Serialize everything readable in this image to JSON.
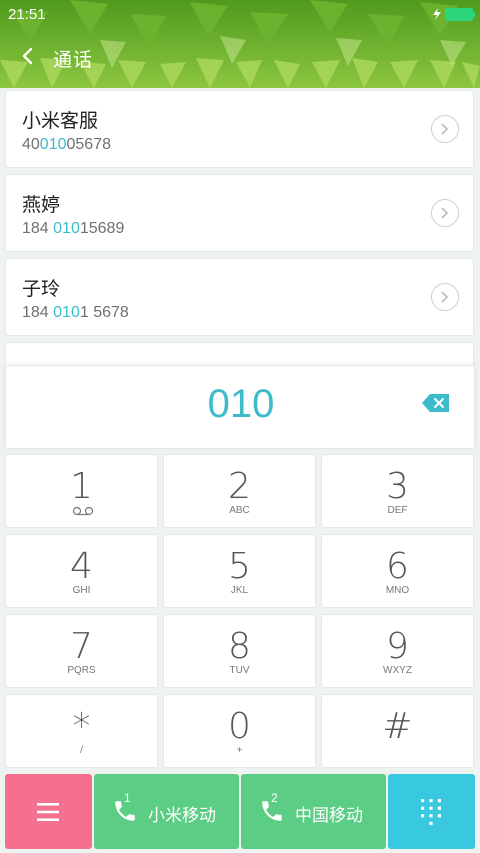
{
  "status_bar": {
    "time": "21:51"
  },
  "header": {
    "title": "通话"
  },
  "contacts": [
    {
      "name": "小米客服",
      "number_parts": [
        "40",
        "010",
        "05678"
      ]
    },
    {
      "name": "燕婷",
      "number_parts": [
        "184 ",
        "010",
        "15689"
      ]
    },
    {
      "name": "子玲",
      "number_parts": [
        "184 ",
        "010",
        "1 5678"
      ]
    }
  ],
  "dialer": {
    "dialed_number": "010"
  },
  "keypad": [
    {
      "digit": "1",
      "letters": ""
    },
    {
      "digit": "2",
      "letters": "ABC"
    },
    {
      "digit": "3",
      "letters": "DEF"
    },
    {
      "digit": "4",
      "letters": "GHI"
    },
    {
      "digit": "5",
      "letters": "JKL"
    },
    {
      "digit": "6",
      "letters": "MNO"
    },
    {
      "digit": "7",
      "letters": "PQRS"
    },
    {
      "digit": "8",
      "letters": "TUV"
    },
    {
      "digit": "9",
      "letters": "WXYZ"
    },
    {
      "digit": "*",
      "letters": "/"
    },
    {
      "digit": "0",
      "letters": "+"
    },
    {
      "digit": "#",
      "letters": ""
    }
  ],
  "bottom_bar": {
    "sim1": {
      "index": "1",
      "label": "小米移动"
    },
    "sim2": {
      "index": "2",
      "label": "中国移动"
    }
  },
  "colors": {
    "accent": "#3cbccb",
    "menu_button": "#f5708e",
    "call_button": "#5ccd84",
    "dialpad_button": "#38c9e0",
    "battery": "#2bd67b"
  },
  "icons": [
    "back-arrow-icon",
    "charge-icon",
    "battery-icon",
    "chevron-right-icon",
    "backspace-icon",
    "voicemail-icon",
    "menu-icon",
    "phone-icon",
    "dialpad-icon"
  ]
}
